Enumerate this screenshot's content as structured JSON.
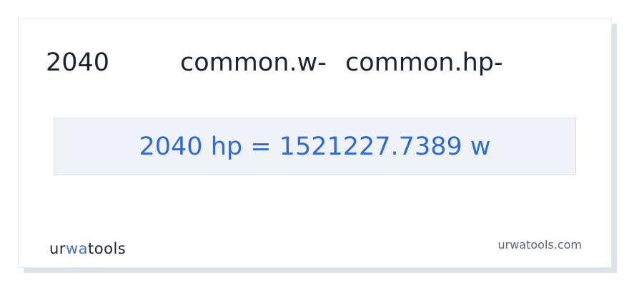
{
  "header": {
    "value": "2040",
    "from_unit": "common.w-",
    "to_unit": "common.hp-"
  },
  "result": {
    "text": "2040 hp = 1521227.7389 w"
  },
  "footer": {
    "logo": {
      "part1": "ur",
      "part2": "wa",
      "part3": "too",
      "part4": "ls"
    },
    "site_url": "urwatools.com"
  },
  "colors": {
    "accent": "#2f6bd6",
    "text": "#1b2333",
    "result_bg": "#eff3f8"
  }
}
